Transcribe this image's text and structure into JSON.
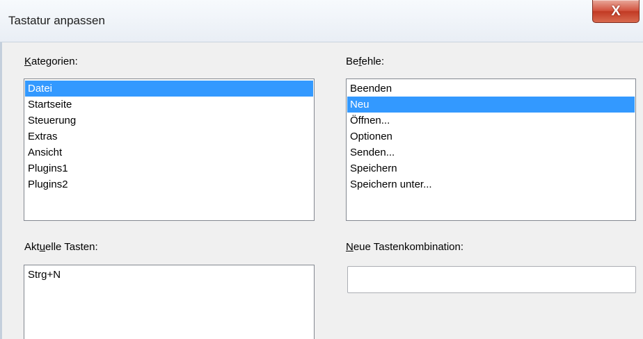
{
  "window": {
    "title": "Tastatur anpassen",
    "close_label": "X"
  },
  "categories": {
    "label": "Kategorien:",
    "underline": "K",
    "items": [
      {
        "label": "Datei",
        "selected": true
      },
      {
        "label": "Startseite",
        "selected": false
      },
      {
        "label": "Steuerung",
        "selected": false
      },
      {
        "label": "Extras",
        "selected": false
      },
      {
        "label": "Ansicht",
        "selected": false
      },
      {
        "label": "Plugins1",
        "selected": false
      },
      {
        "label": "Plugins2",
        "selected": false
      }
    ]
  },
  "commands": {
    "label": "Befehle:",
    "underline": "f",
    "items": [
      {
        "label": "Beenden",
        "selected": false
      },
      {
        "label": "Neu",
        "selected": true
      },
      {
        "label": "Öffnen...",
        "selected": false
      },
      {
        "label": "Optionen",
        "selected": false
      },
      {
        "label": "Senden...",
        "selected": false
      },
      {
        "label": "Speichern",
        "selected": false
      },
      {
        "label": "Speichern unter...",
        "selected": false
      }
    ]
  },
  "current_keys": {
    "label": "Aktuelle Tasten:",
    "underline": "u",
    "items": [
      "Strg+N"
    ]
  },
  "new_shortcut": {
    "label": "Neue Tastenkombination:",
    "underline": "N",
    "value": ""
  },
  "colors": {
    "selection": "#3399ff",
    "close_button": "#c13a24"
  }
}
